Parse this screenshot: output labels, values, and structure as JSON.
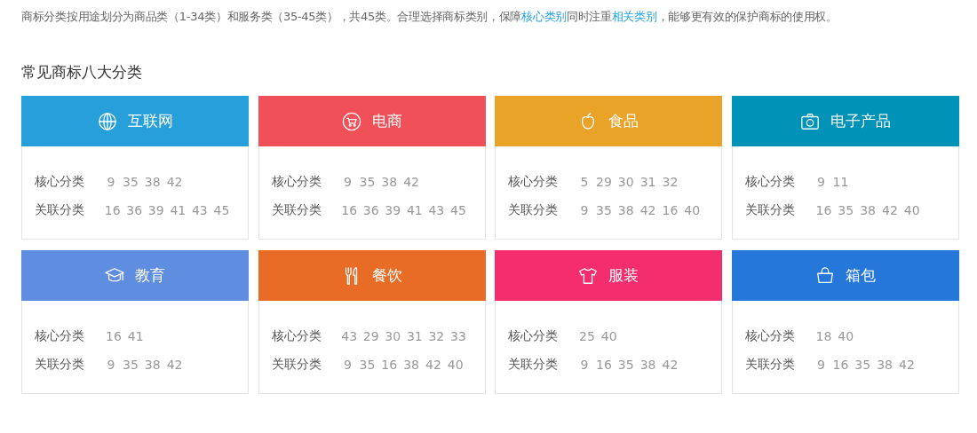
{
  "intro": [
    {
      "kind": "text",
      "text": "商标分类按用途划分为商品类（1-34类）和服务类（35-45类），共45类。合理选择商标类别，保障"
    },
    {
      "kind": "link",
      "text": "核心类别"
    },
    {
      "kind": "text",
      "text": "同时注重"
    },
    {
      "kind": "link",
      "text": "相关类别"
    },
    {
      "kind": "text",
      "text": "，能够更有效的保护商标的使用权。"
    }
  ],
  "section_title": "常见商标八大分类",
  "categories": [
    {
      "name": "互联网",
      "kind": "globe",
      "color": "#279fdb",
      "rows": [
        {
          "label": "核心分类",
          "numbers": [
            "9",
            "35",
            "38",
            "42"
          ]
        },
        {
          "label": "关联分类",
          "numbers": [
            "16",
            "36",
            "39",
            "41",
            "43",
            "45"
          ]
        }
      ]
    },
    {
      "name": "电商",
      "kind": "cart",
      "color": "#f05158",
      "rows": [
        {
          "label": "核心分类",
          "numbers": [
            "9",
            "35",
            "38",
            "42"
          ]
        },
        {
          "label": "关联分类",
          "numbers": [
            "16",
            "36",
            "39",
            "41",
            "43",
            "45"
          ]
        }
      ]
    },
    {
      "name": "食品",
      "kind": "apple",
      "color": "#e8a328",
      "rows": [
        {
          "label": "核心分类",
          "numbers": [
            "5",
            "29",
            "30",
            "31",
            "32"
          ]
        },
        {
          "label": "关联分类",
          "numbers": [
            "9",
            "35",
            "38",
            "42",
            "16",
            "40"
          ]
        }
      ]
    },
    {
      "name": "电子产品",
      "kind": "camera",
      "color": "#0193b7",
      "rows": [
        {
          "label": "核心分类",
          "numbers": [
            "9",
            "11"
          ]
        },
        {
          "label": "关联分类",
          "numbers": [
            "16",
            "35",
            "38",
            "42",
            "40"
          ]
        }
      ]
    },
    {
      "name": "教育",
      "kind": "cap",
      "color": "#5f8de0",
      "rows": [
        {
          "label": "核心分类",
          "numbers": [
            "16",
            "41"
          ]
        },
        {
          "label": "关联分类",
          "numbers": [
            "9",
            "35",
            "38",
            "42"
          ]
        }
      ]
    },
    {
      "name": "餐饮",
      "kind": "cutlery",
      "color": "#e86c26",
      "rows": [
        {
          "label": "核心分类",
          "numbers": [
            "43",
            "29",
            "30",
            "31",
            "32",
            "33"
          ]
        },
        {
          "label": "关联分类",
          "numbers": [
            "9",
            "35",
            "16",
            "38",
            "42",
            "40"
          ]
        }
      ]
    },
    {
      "name": "服装",
      "kind": "shirt",
      "color": "#f32d6e",
      "rows": [
        {
          "label": "核心分类",
          "numbers": [
            "25",
            "40"
          ]
        },
        {
          "label": "关联分类",
          "numbers": [
            "9",
            "16",
            "35",
            "38",
            "42"
          ]
        }
      ]
    },
    {
      "name": "箱包",
      "kind": "bag",
      "color": "#2577d9",
      "rows": [
        {
          "label": "核心分类",
          "numbers": [
            "18",
            "40"
          ]
        },
        {
          "label": "关联分类",
          "numbers": [
            "9",
            "16",
            "35",
            "38",
            "42"
          ]
        }
      ]
    }
  ]
}
